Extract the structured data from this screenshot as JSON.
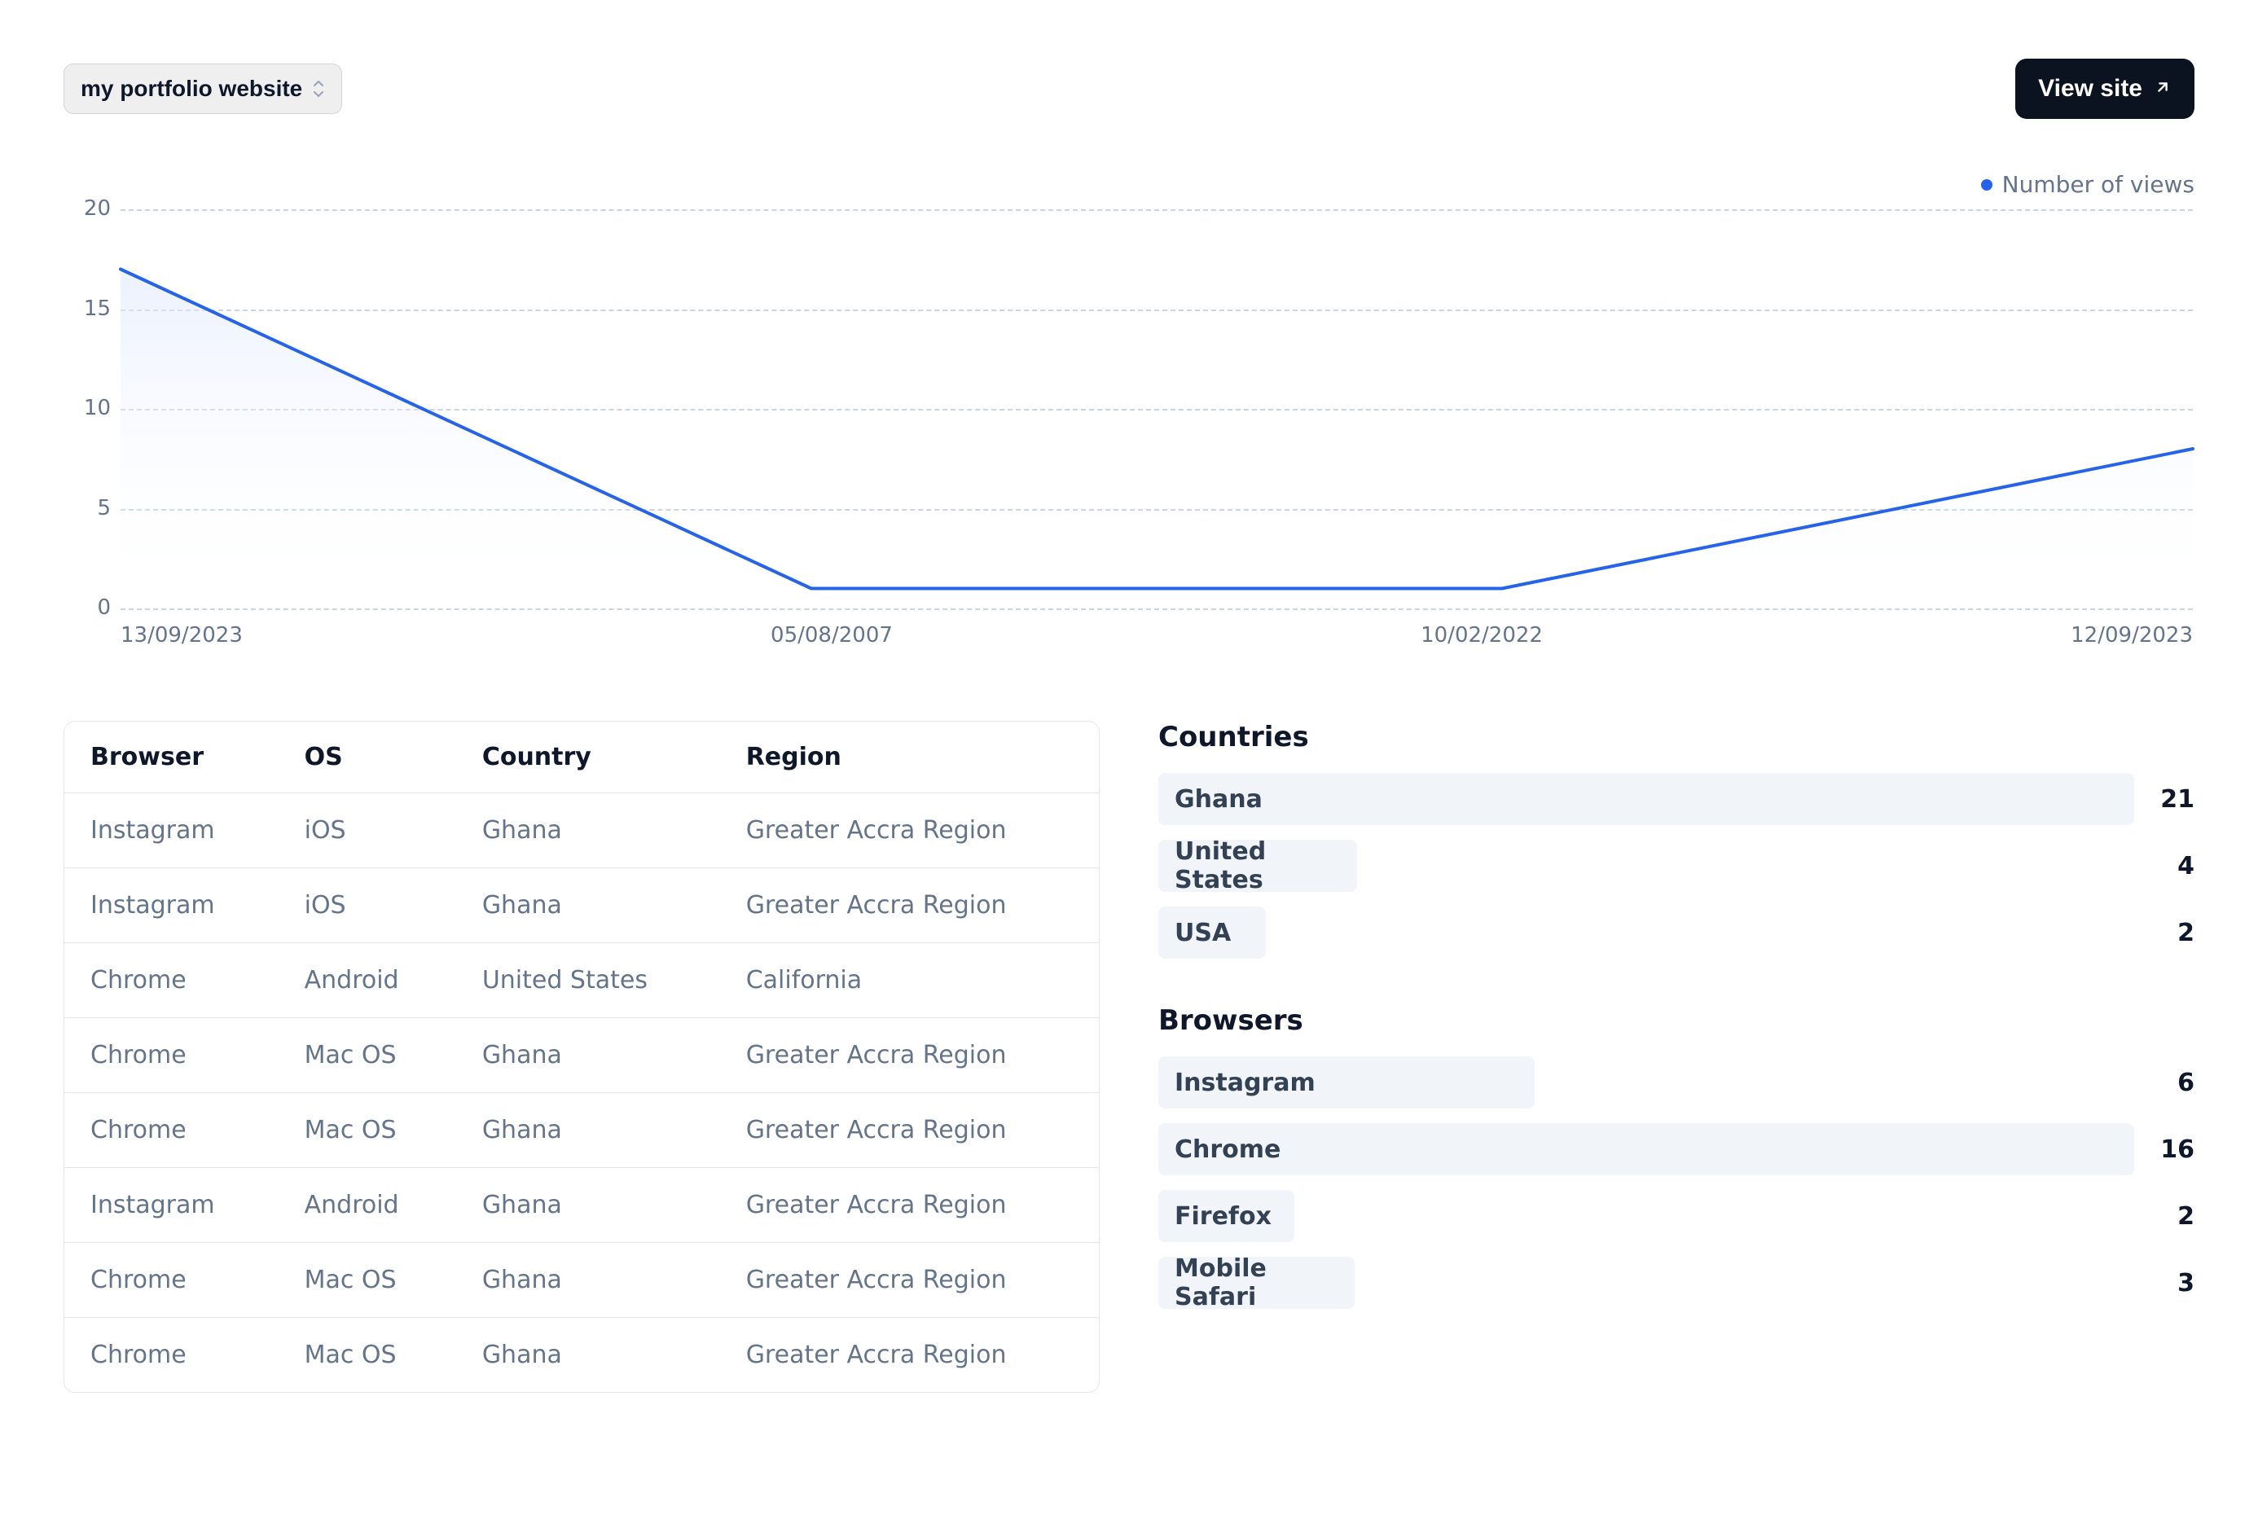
{
  "toolbar": {
    "site_selector_label": "my portfolio website",
    "view_site_label": "View site"
  },
  "legend": {
    "series_label": "Number of views"
  },
  "chart_data": {
    "type": "line",
    "categories": [
      "13/09/2023",
      "05/08/2007",
      "10/02/2022",
      "12/09/2023"
    ],
    "x_index": [
      0,
      1,
      2,
      3
    ],
    "series": [
      {
        "name": "Number of views",
        "values": [
          17,
          1,
          1,
          8
        ]
      }
    ],
    "xlabel": "",
    "ylabel": "",
    "ylim": [
      0,
      20
    ],
    "y_ticks": [
      20,
      15,
      10,
      5,
      0
    ],
    "grid_y": true,
    "legend_position": "top-right",
    "colors": {
      "line": "#2563eb",
      "fill_top": "#dbe6fe",
      "fill_bottom": "#ffffff"
    }
  },
  "table": {
    "columns": [
      "Browser",
      "OS",
      "Country",
      "Region"
    ],
    "rows": [
      [
        "Instagram",
        "iOS",
        "Ghana",
        "Greater Accra Region"
      ],
      [
        "Instagram",
        "iOS",
        "Ghana",
        "Greater Accra Region"
      ],
      [
        "Chrome",
        "Android",
        "United States",
        "California"
      ],
      [
        "Chrome",
        "Mac OS",
        "Ghana",
        "Greater Accra Region"
      ],
      [
        "Chrome",
        "Mac OS",
        "Ghana",
        "Greater Accra Region"
      ],
      [
        "Instagram",
        "Android",
        "Ghana",
        "Greater Accra Region"
      ],
      [
        "Chrome",
        "Mac OS",
        "Ghana",
        "Greater Accra Region"
      ],
      [
        "Chrome",
        "Mac OS",
        "Ghana",
        "Greater Accra Region"
      ]
    ]
  },
  "countries_panel": {
    "title": "Countries",
    "items": [
      {
        "label": "Ghana",
        "count": 21
      },
      {
        "label": "United States",
        "count": 4
      },
      {
        "label": "USA",
        "count": 2
      }
    ]
  },
  "browsers_panel": {
    "title": "Browsers",
    "items": [
      {
        "label": "Instagram",
        "count": 6
      },
      {
        "label": "Chrome",
        "count": 16
      },
      {
        "label": "Firefox",
        "count": 2
      },
      {
        "label": "Mobile Safari",
        "count": 3
      }
    ]
  }
}
